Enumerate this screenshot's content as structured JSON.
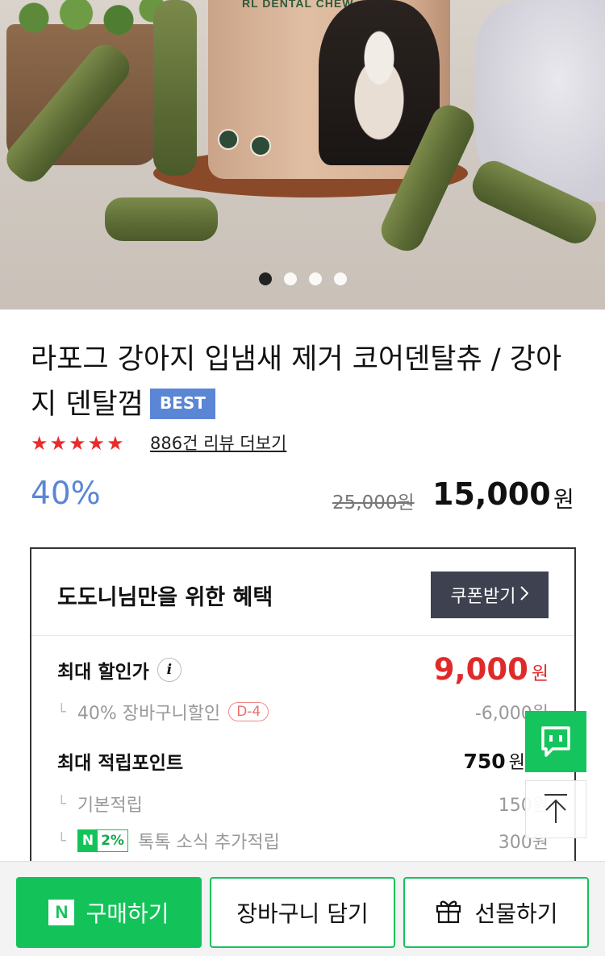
{
  "hero": {
    "label_text": "RL DENTAL CHEW",
    "carousel": {
      "total": 4,
      "active": 1
    }
  },
  "product": {
    "title": "라포그 강아지 입냄새 제거 코어덴탈츄 / 강아지 덴탈껌",
    "badge": "BEST",
    "rating_stars": 5,
    "review_link": "886건 리뷰 더보기",
    "discount_rate": "40%",
    "original_price": "25,000원",
    "sale_price": "15,000",
    "price_unit": "원"
  },
  "benefit": {
    "title": "도도니님만을 위한 혜택",
    "coupon_button": "쿠폰받기",
    "max_discount_label": "최대 할인가",
    "max_discount_price": "9,000",
    "currency": "원",
    "cart_discount_label": "40% 장바구니할인",
    "cart_discount_dday": "D-4",
    "cart_discount_amount": "-6,000원",
    "max_points_label": "최대 적립포인트",
    "max_points_value": "750",
    "basic_points_label": "기본적립",
    "basic_points_value": "150원",
    "talk_badge_brand": "N",
    "talk_badge_rate": "2%",
    "talk_points_label": "톡톡 소식 추가적립",
    "talk_points_value": "300원"
  },
  "bottom_bar": {
    "buy": "구매하기",
    "cart": "장바구니 담기",
    "gift": "선물하기",
    "buy_logo": "N"
  },
  "colors": {
    "accent_green": "#13c35a",
    "discount_blue": "#5b86d6",
    "price_red": "#e02a2a",
    "star_red": "#ea2b2b"
  }
}
